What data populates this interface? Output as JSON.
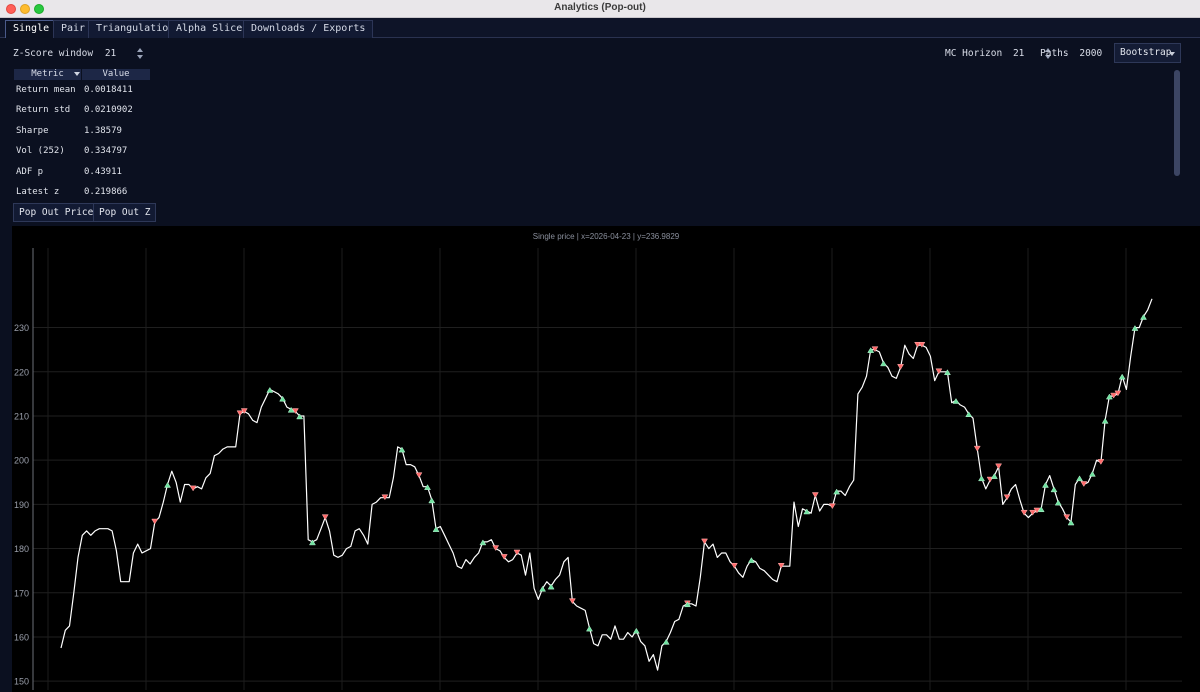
{
  "window": {
    "title": "Analytics (Pop-out)"
  },
  "tabs": [
    {
      "label": "Single",
      "active": true
    },
    {
      "label": "Pair",
      "active": false
    },
    {
      "label": "Triangulation",
      "active": false
    },
    {
      "label": "Alpha Slices",
      "active": false
    },
    {
      "label": "Downloads / Exports",
      "active": false
    }
  ],
  "controls": {
    "zscore_label": "Z-Score window",
    "zscore_value": "21",
    "mc_horizon_label": "MC Horizon",
    "mc_horizon_value": "21",
    "paths_label": "Paths",
    "paths_value": "2000",
    "method": "Bootstrap"
  },
  "metrics": {
    "headers": [
      "Metric",
      "Value"
    ],
    "rows": [
      {
        "metric": "Return mean",
        "value": "0.0018411"
      },
      {
        "metric": "Return std",
        "value": "0.0210902"
      },
      {
        "metric": "Sharpe",
        "value": "1.38579"
      },
      {
        "metric": "Vol (252)",
        "value": "0.334797"
      },
      {
        "metric": "ADF p",
        "value": "0.43911"
      },
      {
        "metric": "Latest z",
        "value": "0.219866"
      }
    ]
  },
  "buttons": {
    "pop_price": "Pop Out Price",
    "pop_z": "Pop Out Z"
  },
  "chart_data": {
    "type": "line",
    "title": "Single price | x=2026-04-23 | y=236.9829",
    "ylim": [
      148,
      248
    ],
    "yticks": [
      150,
      160,
      170,
      180,
      190,
      200,
      210,
      220,
      230
    ],
    "grid": true,
    "colors": {
      "line": "#ffffff",
      "sell_marker": "#ff6b6b",
      "buy_marker": "#6fe3a0"
    },
    "series": [
      {
        "values": [
          157.5,
          161.5,
          162.5,
          170,
          178,
          183,
          184,
          183,
          184,
          184.5,
          184.5,
          184.5,
          184,
          179.5,
          172.5,
          172.5,
          172.5,
          179,
          181,
          179,
          179.5,
          180,
          186,
          187,
          190.5,
          194.5,
          197.5,
          195,
          190.5,
          194.5,
          194.5,
          193.5,
          194,
          193.5,
          196,
          197,
          201,
          201.5,
          202.5,
          203,
          203,
          203,
          210.5,
          211,
          210.5,
          209,
          208.5,
          212,
          214,
          216,
          215.5,
          215,
          214,
          212,
          211.5,
          211,
          210,
          210,
          182,
          181.5,
          182,
          184.5,
          187,
          184,
          178.5,
          178,
          178.5,
          180,
          180.5,
          184,
          184.5,
          183,
          181,
          190,
          190.5,
          191.5,
          191.5,
          191.5,
          196,
          203,
          202.5,
          199,
          199,
          198.5,
          196.5,
          194,
          194,
          191,
          184.5,
          185,
          183,
          181,
          179,
          176,
          175.5,
          177.5,
          176.5,
          178,
          179,
          181.5,
          181.5,
          182,
          180,
          179.5,
          178,
          177,
          177.5,
          179,
          178.5,
          174,
          179,
          171,
          168.5,
          171,
          172.5,
          171.5,
          173,
          174,
          177,
          178,
          168,
          167,
          166.5,
          166,
          162,
          158.5,
          158,
          160.5,
          160.5,
          159.5,
          162.5,
          159.5,
          159.5,
          161,
          160,
          161.5,
          159,
          158,
          154.5,
          156,
          152.5,
          158,
          159,
          161,
          163.5,
          164,
          167,
          167.5,
          167.5,
          167,
          173.5,
          181.5,
          180,
          181,
          178,
          179,
          179,
          177,
          176,
          174.5,
          173.5,
          176,
          177.5,
          177,
          175.5,
          175,
          174,
          173,
          172.5,
          176,
          176,
          176,
          190.5,
          185,
          189,
          188.5,
          188,
          192,
          188.5,
          190,
          190,
          189.5,
          193,
          193,
          192,
          194,
          195.5,
          215,
          216.5,
          219,
          225,
          225,
          224.5,
          222,
          221,
          219,
          218.5,
          221,
          226,
          224,
          223,
          226,
          226,
          225.5,
          223.5,
          218,
          220,
          220,
          220,
          213,
          213.5,
          212.5,
          212,
          210.5,
          209.5,
          202.5,
          196,
          193.5,
          195.5,
          196.5,
          198.5,
          190,
          191.5,
          193.5,
          194.5,
          191,
          188,
          187,
          188,
          188.5,
          189,
          194.5,
          196.5,
          193.5,
          190.5,
          189,
          187,
          186,
          194.5,
          196,
          194.5,
          195,
          197,
          200,
          199.5,
          209,
          214.5,
          214.5,
          215,
          219,
          216,
          223.5,
          230,
          230,
          232.5,
          234,
          236.5
        ],
        "sell_markers_at": [
          22,
          31,
          42,
          43,
          55,
          62,
          76,
          84,
          102,
          104,
          107,
          120,
          147,
          151,
          158,
          169,
          177,
          181,
          191,
          197,
          201,
          202,
          206,
          215,
          218,
          220,
          222,
          226,
          228,
          229,
          236,
          240,
          244,
          247,
          248,
          260,
          263,
          265,
          266
        ],
        "buy_markers_at": [
          25,
          49,
          52,
          54,
          56,
          59,
          80,
          86,
          87,
          88,
          99,
          113,
          115,
          124,
          135,
          142,
          147,
          162,
          175,
          182,
          190,
          193,
          208,
          210,
          213,
          216,
          219,
          230,
          231,
          233,
          234,
          237,
          239,
          242,
          245,
          246,
          249,
          252,
          254,
          258
        ]
      }
    ]
  }
}
